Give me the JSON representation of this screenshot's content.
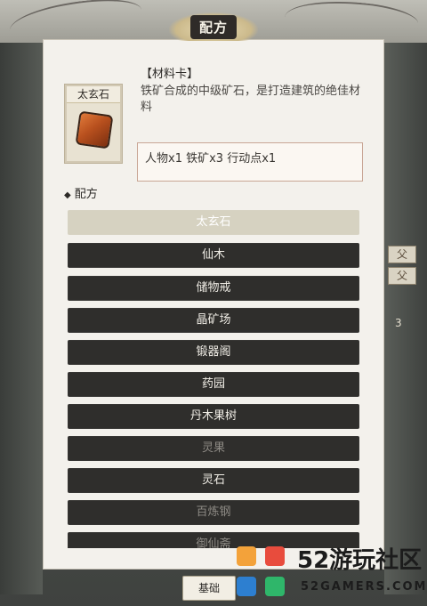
{
  "window": {
    "title": "配方"
  },
  "item": {
    "name": "太玄石",
    "heading": "【材料卡】",
    "description": "铁矿合成的中级矿石，是打造建筑的绝佳材料",
    "cost": "人物x1 铁矿x3 行动点x1"
  },
  "recipes": {
    "section_label": "配方",
    "items": [
      {
        "label": "太玄石",
        "state": "selected"
      },
      {
        "label": "仙木",
        "state": "normal"
      },
      {
        "label": "储物戒",
        "state": "normal"
      },
      {
        "label": "晶矿场",
        "state": "normal"
      },
      {
        "label": "锻器阁",
        "state": "normal"
      },
      {
        "label": "药园",
        "state": "normal"
      },
      {
        "label": "丹木果树",
        "state": "normal"
      },
      {
        "label": "灵果",
        "state": "disabled"
      },
      {
        "label": "灵石",
        "state": "normal"
      },
      {
        "label": "百炼钢",
        "state": "disabled"
      },
      {
        "label": "御仙斋",
        "state": "disabled"
      }
    ]
  },
  "bottom": {
    "basic_label": "基础"
  },
  "side": {
    "tag_1": "父",
    "tag_2": "父",
    "count": "3"
  },
  "watermark": {
    "line1": "52游玩社区",
    "line2": "52GAMERS.COM"
  },
  "colors": {
    "accent": "#d6d2c1",
    "bar": "#2f2e2c",
    "paper": "#f3f1ec"
  }
}
